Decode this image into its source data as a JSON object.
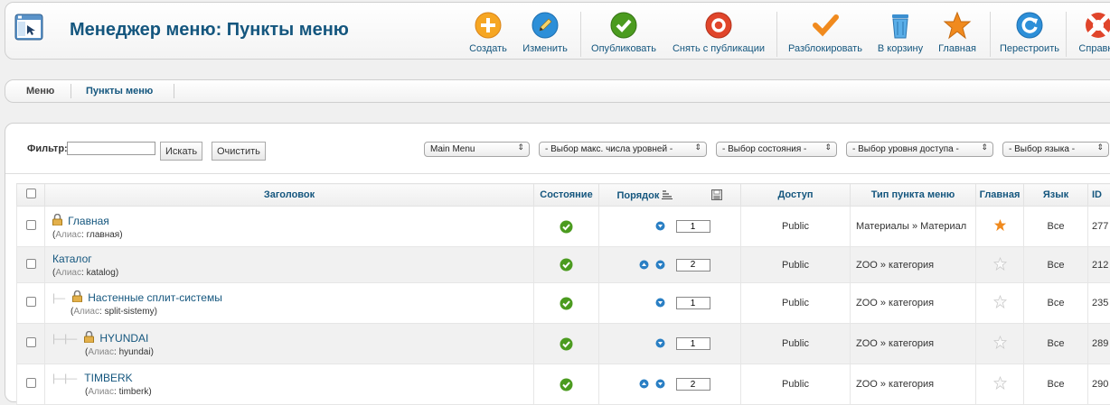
{
  "header": {
    "title": "Менеджер меню: Пункты меню",
    "icon": "menu-manager-icon"
  },
  "toolbar": {
    "create": "Создать",
    "edit": "Изменить",
    "publish": "Опубликовать",
    "unpublish": "Снять с публикации",
    "checkin": "Разблокировать",
    "trash": "В корзину",
    "home": "Главная",
    "rebuild": "Перестроить",
    "help": "Справка"
  },
  "submenu": {
    "menus": "Меню",
    "items": "Пункты меню"
  },
  "filter": {
    "label": "Фильтр:",
    "value": "",
    "search_button": "Искать",
    "clear_button": "Очистить"
  },
  "selects": {
    "menu": "Main Menu",
    "levels": "- Выбор макс. числа уровней -",
    "state": "- Выбор состояния -",
    "access": "- Выбор уровня доступа -",
    "language": "- Выбор языка -"
  },
  "table": {
    "columns": {
      "title": "Заголовок",
      "state": "Состояние",
      "order": "Порядок",
      "access": "Доступ",
      "type": "Тип пункта меню",
      "home": "Главная",
      "language": "Язык",
      "id": "ID"
    },
    "alias_label": "Алиас",
    "rows": [
      {
        "title": "Главная",
        "alias": "главная",
        "order": "1",
        "access": "Public",
        "type": "Материалы » Материал",
        "language": "Все",
        "id": "277"
      },
      {
        "title": "Каталог",
        "alias": "katalog",
        "order": "2",
        "access": "Public",
        "type": "ZOO » категория",
        "language": "Все",
        "id": "212"
      },
      {
        "title": "Настенные сплит-системы",
        "alias": "split-sistemy",
        "order": "1",
        "access": "Public",
        "type": "ZOO » категория",
        "language": "Все",
        "id": "235"
      },
      {
        "title": "HYUNDAI",
        "alias": "hyundai",
        "order": "1",
        "access": "Public",
        "type": "ZOO » категория",
        "language": "Все",
        "id": "289"
      },
      {
        "title": "TIMBERK",
        "alias": "timberk",
        "order": "2",
        "access": "Public",
        "type": "ZOO » категория",
        "language": "Все",
        "id": "290"
      }
    ]
  },
  "colors": {
    "accent": "#14567e",
    "published": "#4b9b1f",
    "home_star": "#f08a1e"
  }
}
